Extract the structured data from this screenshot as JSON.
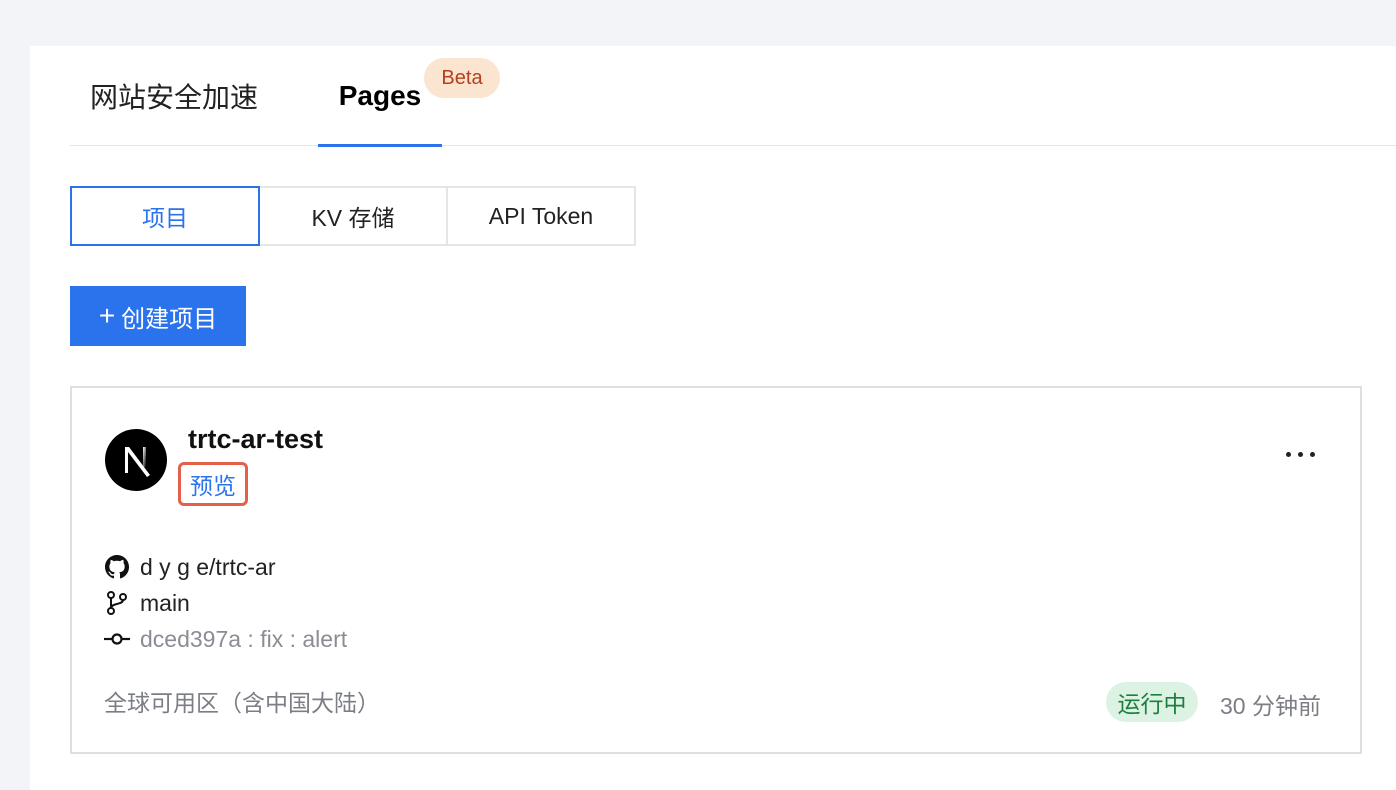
{
  "top_tabs": [
    {
      "label": "网站安全加速"
    },
    {
      "label": "Pages",
      "badge": "Beta"
    }
  ],
  "sub_tabs": [
    {
      "label": "项目"
    },
    {
      "label": "KV 存储"
    },
    {
      "label": "API Token"
    }
  ],
  "create_button": {
    "plus": "+",
    "label": "创建项目"
  },
  "project": {
    "name": "trtc-ar-test",
    "preview_label": "预览",
    "repo": "d      y g    e/trtc-ar",
    "branch": "main",
    "commit": "dced397a : fix : alert",
    "region": "全球可用区（含中国大陆）",
    "status": "运行中",
    "updated": "30 分钟前",
    "logo_letter": "N",
    "icons": {
      "repo": "github-icon",
      "branch": "git-branch-icon",
      "commit": "git-commit-icon",
      "more": "more-horizontal-icon"
    }
  },
  "colors": {
    "accent": "#2b73ec",
    "highlight_border": "#e4604b",
    "status_bg": "#dcf2e3",
    "status_text": "#1d7f3d",
    "beta_bg": "#fbe4d0",
    "beta_text": "#b5401c"
  }
}
